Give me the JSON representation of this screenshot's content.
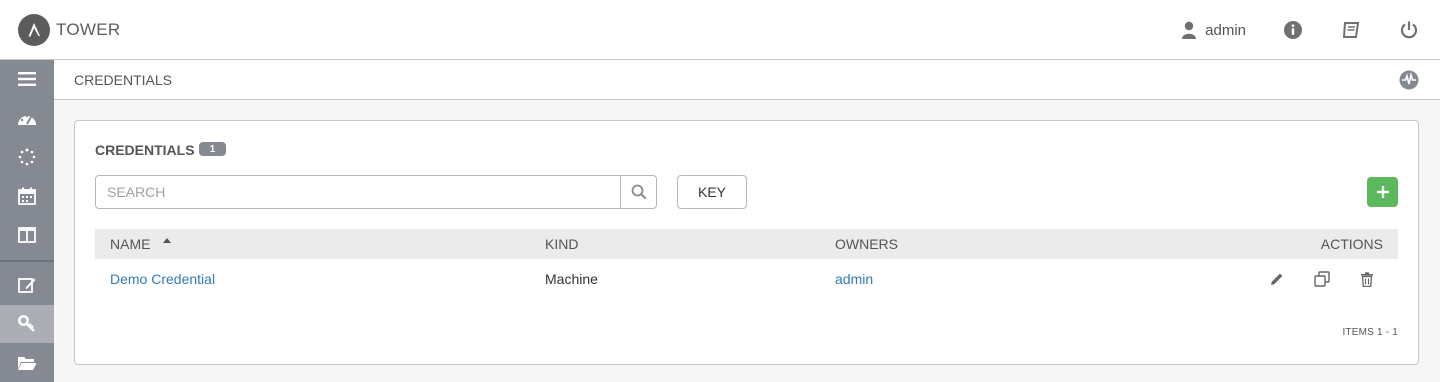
{
  "app": {
    "name": "TOWER"
  },
  "header": {
    "user": "admin",
    "icons": [
      "user-icon",
      "info-icon",
      "book-icon",
      "power-icon"
    ]
  },
  "sidebar": {
    "items": [
      {
        "name": "menu",
        "icon": "hamburger-icon"
      },
      {
        "name": "dashboard",
        "icon": "dashboard-icon"
      },
      {
        "name": "jobs",
        "icon": "spinner-icon"
      },
      {
        "name": "schedules",
        "icon": "calendar-icon"
      },
      {
        "name": "portal",
        "icon": "columns-icon"
      },
      {
        "name": "projects",
        "icon": "edit-icon"
      },
      {
        "name": "credentials",
        "icon": "key-icon",
        "active": true
      },
      {
        "name": "inventories",
        "icon": "folder-icon"
      }
    ]
  },
  "breadcrumb": "CREDENTIALS",
  "panel": {
    "title": "CREDENTIALS",
    "count": "1",
    "search_placeholder": "SEARCH",
    "key_label": "KEY",
    "columns": [
      "NAME",
      "KIND",
      "OWNERS",
      "ACTIONS"
    ],
    "rows": [
      {
        "name": "Demo Credential",
        "kind": "Machine",
        "owners": "admin"
      }
    ],
    "pagination": "ITEMS  1 - 1"
  },
  "colors": {
    "accent_green": "#5cb85c",
    "link_blue": "#337ab7",
    "sidebar": "#848992"
  }
}
